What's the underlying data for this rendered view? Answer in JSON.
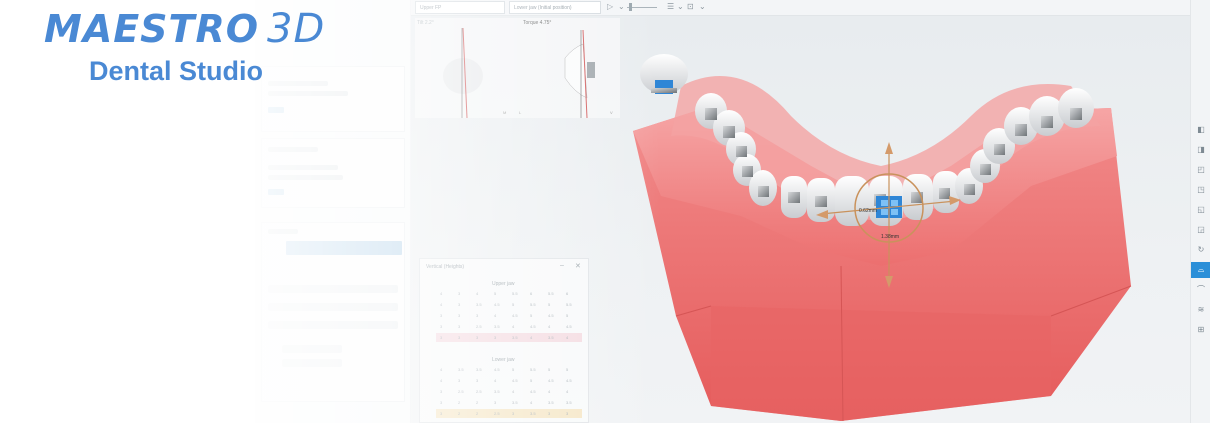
{
  "toolbar": {
    "structure_select": "Upper FP",
    "jaw_select": "Lower jaw (Initial position)"
  },
  "viewport": {
    "xray": {
      "left_label": "Tilt 2.2°",
      "right_label": "Torque 4.75°",
      "marks": [
        "M",
        "L",
        "V"
      ]
    },
    "measurements": {
      "horizontal": "0.62mm",
      "vertical": "1.38mm"
    }
  },
  "logo": {
    "brand": "MAESTRO",
    "brand_3d": "3D",
    "subtitle": "Dental Studio"
  },
  "table_panel": {
    "title": "Vertical (Heights)",
    "upper_heading": "Upper jaw",
    "lower_heading": "Lower jaw",
    "upper_rows": [
      [
        "4",
        "3",
        "4",
        "5",
        "5.5",
        "6",
        "5.5",
        "6"
      ],
      [
        "4",
        "3",
        "3.5",
        "4.5",
        "5",
        "5.5",
        "5",
        "5.5"
      ],
      [
        "3",
        "3",
        "3",
        "4",
        "4.5",
        "5",
        "4.5",
        "5"
      ],
      [
        "3",
        "3",
        "2.5",
        "3.5",
        "4",
        "4.5",
        "4",
        "4.5"
      ],
      [
        "3",
        "3",
        "3",
        "3",
        "3.5",
        "4",
        "3.5",
        "4"
      ]
    ],
    "lower_rows": [
      [
        "4",
        "3.5",
        "3.5",
        "4.5",
        "5",
        "5.5",
        "5",
        "5"
      ],
      [
        "4",
        "3",
        "3",
        "4",
        "4.5",
        "5",
        "4.5",
        "4.5"
      ],
      [
        "3",
        "2.5",
        "2.5",
        "3.5",
        "4",
        "4.5",
        "4",
        "4"
      ],
      [
        "3",
        "2",
        "2",
        "3",
        "3.5",
        "4",
        "3.5",
        "3.5"
      ],
      [
        "3",
        "2",
        "2",
        "2.5",
        "3",
        "3.5",
        "3",
        "3"
      ]
    ]
  },
  "colors": {
    "brand_blue": "#4a89d4",
    "gum_red": "#ef7f7f",
    "active_blue": "#2b8fd8"
  },
  "sidebar_icons": [
    "view-front-icon",
    "view-back-icon",
    "view-left-icon",
    "view-right-icon",
    "view-top-icon",
    "view-bottom-icon",
    "rotate-icon",
    "upper-jaw-icon",
    "lower-jaw-icon",
    "both-jaws-icon",
    "grid-icon"
  ]
}
